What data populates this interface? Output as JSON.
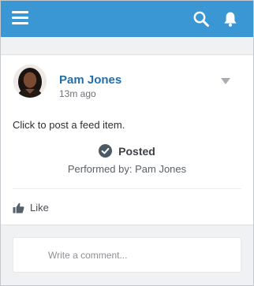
{
  "header": {
    "menu_icon": "hamburger-menu-icon",
    "search_icon": "search-icon",
    "notifications_icon": "bell-icon",
    "background": "#3b97d3"
  },
  "post": {
    "author": "Pam Jones",
    "time": "13m ago",
    "body": "Click to post a feed item.",
    "status": "Posted",
    "performed_by": "Performed by: Pam Jones",
    "actions_icon": "chevron-down-icon",
    "status_icon": "check-circle-icon"
  },
  "actions": {
    "like_label": "Like",
    "like_icon": "thumbs-up-icon"
  },
  "comment": {
    "placeholder": "Write a comment..."
  },
  "colors": {
    "accent": "#3b97d3",
    "link": "#1f6fad"
  }
}
